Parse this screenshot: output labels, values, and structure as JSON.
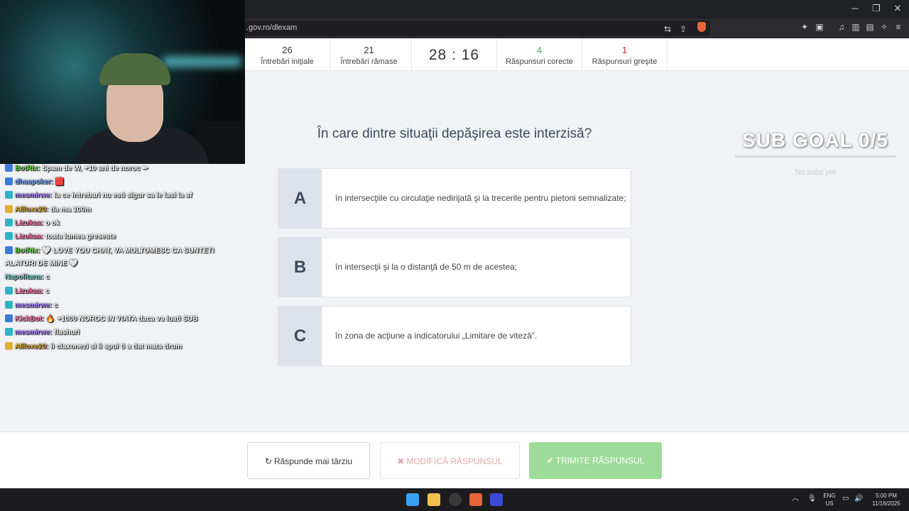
{
  "browser": {
    "url": ".gov.ro/dlexam",
    "window_controls": {
      "minimize": "─",
      "restore": "❐",
      "close": "✕"
    }
  },
  "stats": {
    "initial": {
      "value": "26",
      "label": "Întrebări iniţiale"
    },
    "remaining": {
      "value": "21",
      "label": "Întrebări rămase"
    },
    "timer": "28 : 16",
    "correct": {
      "value": "4",
      "label": "Răspunsuri corecte",
      "color": "#4caf50"
    },
    "wrong": {
      "value": "1",
      "label": "Răspunsuri greşite",
      "color": "#c62828"
    }
  },
  "question": "În care dintre situaţii depăşirea este interzisă?",
  "answers": [
    {
      "letter": "A",
      "text": "în intersecţiile cu circulaţie nedirijată şi la trecerile pentru pietoni semnalizate;"
    },
    {
      "letter": "B",
      "text": "în intersecţii şi la o distanţă de 50 m de acestea;"
    },
    {
      "letter": "C",
      "text": "în zona de acţiune a indicatorului „Limitare de viteză”."
    }
  ],
  "buttons": {
    "later": {
      "icon": "↻",
      "label": "Răspunde mai târziu"
    },
    "modify": {
      "icon": "✖",
      "label": "MODIFICĂ RĂSPUNSUL"
    },
    "submit": {
      "icon": "✔",
      "label": "TRIMITE RĂSPUNSUL"
    }
  },
  "overlay": {
    "sub_goal": "SUB GOAL 0/5",
    "no_subs": "No subs yet"
  },
  "chat": [
    {
      "user": "BotRix:",
      "user_color": "#6fdc4b",
      "text": "Spam de W, +10 ani de noroc ✏"
    },
    {
      "user": "dhaspoker:",
      "user_color": "#7aa8ff",
      "text": "🟥"
    },
    {
      "user": "mesmirwe:",
      "user_color": "#b08cff",
      "text": "la ce intrebari nu esti sigur sa le lasi la sf"
    },
    {
      "user": "Allloxe20:",
      "user_color": "#e0b030",
      "text": "da ma 100m"
    },
    {
      "user": "Lizukaa:",
      "user_color": "#ff6fa8",
      "text": "o ok"
    },
    {
      "user": "Lizukaa:",
      "user_color": "#ff6fa8",
      "text": "toata lumea greseste"
    },
    {
      "user": "BotRix:",
      "user_color": "#6fdc4b",
      "text": "🤍 LOVE YOU CHAT, VA MULTUMESC CA SUNTETI"
    },
    {
      "user": "",
      "user_color": "#ffffff",
      "text": "ALATURI DE MINE 🤍"
    },
    {
      "user": "Napolitana:",
      "user_color": "#7bd0c8",
      "text": "c"
    },
    {
      "user": "Lizukaa:",
      "user_color": "#ff6fa8",
      "text": "c"
    },
    {
      "user": "mesmirwe:",
      "user_color": "#b08cff",
      "text": "c"
    },
    {
      "user": "KickBot:",
      "user_color": "#ff7ab0",
      "text": "🔥 +1000 NOROC IN VIATA daca va luati SUB"
    },
    {
      "user": "mesmirwe:",
      "user_color": "#b08cff",
      "text": "flashuri"
    },
    {
      "user": "Allloxe20:",
      "user_color": "#e0b030",
      "text": "ii claxonezi si ii spui ti a dat mata drum"
    }
  ],
  "taskbar": {
    "lang": "ENG",
    "region": "US",
    "time": "5:00 PM",
    "date": "11/16/2025"
  }
}
